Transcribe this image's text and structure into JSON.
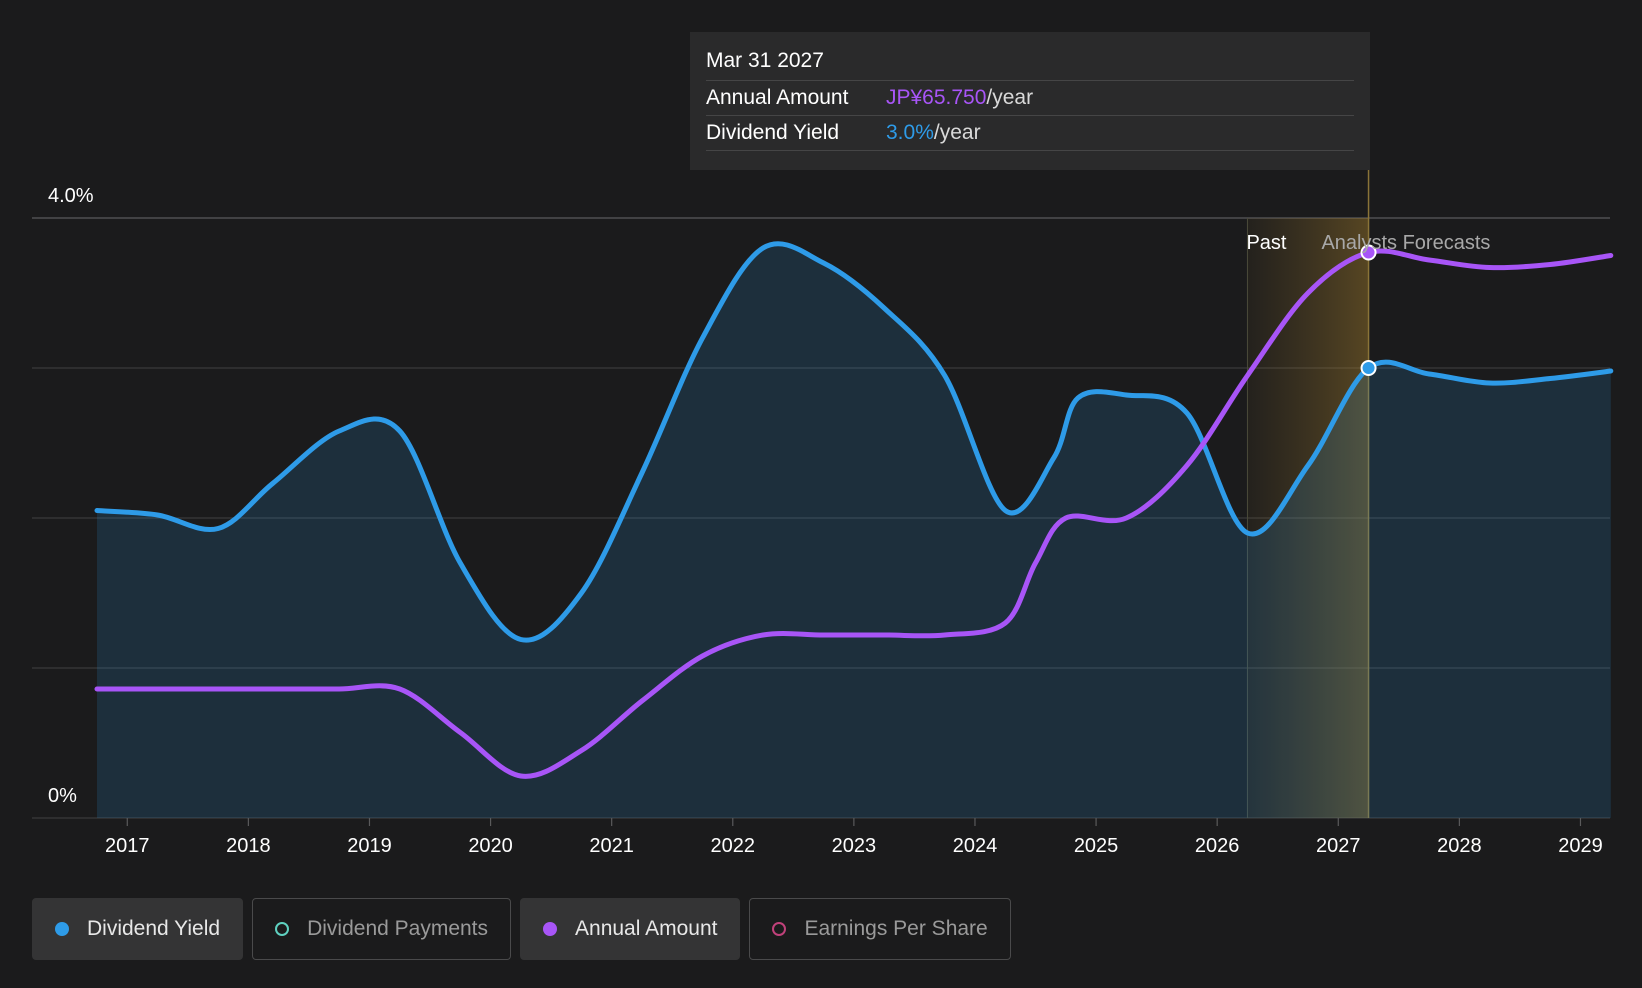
{
  "tooltip": {
    "date": "Mar 31 2027",
    "rows": [
      {
        "label": "Annual Amount",
        "value": "JP¥65.750",
        "unit": "/year"
      },
      {
        "label": "Dividend Yield",
        "value": "3.0%",
        "unit": "/year"
      }
    ]
  },
  "chart_data": {
    "type": "line",
    "yticks": [
      "4.0%",
      "0%"
    ],
    "ylim": [
      0,
      4.0
    ],
    "xlim": [
      2016.74,
      2029.25
    ],
    "xticks": [
      "2017",
      "2018",
      "2019",
      "2020",
      "2021",
      "2022",
      "2023",
      "2024",
      "2025",
      "2026",
      "2027",
      "2028",
      "2029"
    ],
    "grid": true,
    "regions": {
      "past_label": "Past",
      "forecast_label": "Analysts Forecasts",
      "past_start": 2026.25,
      "forecast_start": 2026.75,
      "cursor_x": 2027.25
    },
    "series": [
      {
        "name": "Dividend Yield",
        "color": "#2e9be8",
        "area": true,
        "x": [
          2016.75,
          2017.25,
          2017.75,
          2018.2,
          2018.75,
          2019.25,
          2019.75,
          2020.25,
          2020.75,
          2021.25,
          2021.75,
          2022.25,
          2022.75,
          2023.25,
          2023.75,
          2024.25,
          2024.65,
          2024.85,
          2025.25,
          2025.75,
          2026.25,
          2026.75,
          2027.25,
          2027.75,
          2028.25,
          2028.75,
          2029.25
        ],
        "values": [
          2.05,
          2.02,
          1.93,
          2.23,
          2.58,
          2.58,
          1.7,
          1.19,
          1.5,
          2.3,
          3.2,
          3.8,
          3.7,
          3.4,
          2.95,
          2.05,
          2.4,
          2.8,
          2.82,
          2.7,
          1.9,
          2.35,
          3.0,
          2.96,
          2.9,
          2.93,
          2.98
        ]
      },
      {
        "name": "Annual Amount",
        "color": "#a855f7",
        "area": false,
        "x": [
          2016.75,
          2017.25,
          2017.75,
          2018.25,
          2018.75,
          2019.25,
          2019.75,
          2020.25,
          2020.75,
          2021.25,
          2021.75,
          2022.25,
          2022.75,
          2023.25,
          2023.75,
          2024.25,
          2024.5,
          2024.75,
          2025.25,
          2025.75,
          2026.25,
          2026.75,
          2027.25,
          2027.75,
          2028.25,
          2028.75,
          2029.25
        ],
        "values": [
          0.86,
          0.86,
          0.86,
          0.86,
          0.86,
          0.86,
          0.57,
          0.28,
          0.45,
          0.78,
          1.08,
          1.22,
          1.22,
          1.22,
          1.22,
          1.3,
          1.7,
          2.0,
          2.0,
          2.35,
          2.95,
          3.5,
          3.77,
          3.72,
          3.67,
          3.69,
          3.75
        ]
      }
    ],
    "markers": [
      {
        "series": "Annual Amount",
        "x": 2027.25,
        "value": 3.77
      },
      {
        "series": "Dividend Yield",
        "x": 2027.25,
        "value": 3.0
      }
    ]
  },
  "legend": [
    {
      "label": "Dividend Yield",
      "color": "#2e9be8",
      "active": true,
      "filled": true
    },
    {
      "label": "Dividend Payments",
      "color": "#5fd1c0",
      "active": false,
      "filled": false
    },
    {
      "label": "Annual Amount",
      "color": "#a855f7",
      "active": true,
      "filled": true
    },
    {
      "label": "Earnings Per Share",
      "color": "#c0417a",
      "active": false,
      "filled": false
    }
  ]
}
